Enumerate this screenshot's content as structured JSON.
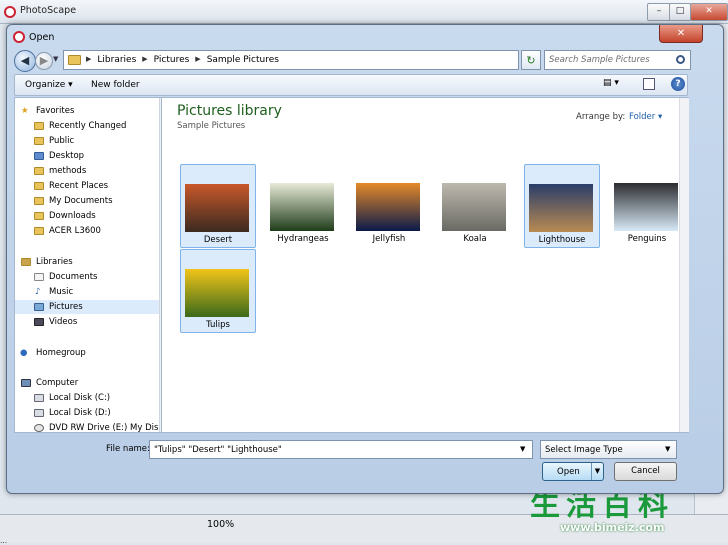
{
  "background_app": {
    "title": "PhotoScape",
    "window_buttons": [
      "–",
      "□",
      "✕"
    ],
    "zoom": "100%",
    "status_text": "...",
    "watermark": "生活百科",
    "watermark_url": "www.bimeiz.com"
  },
  "dialog": {
    "title": "Open",
    "close_label": "✕",
    "breadcrumb": [
      "Libraries",
      "Pictures",
      "Sample Pictures"
    ],
    "search_placeholder": "Search Sample Pictures",
    "toolbar": {
      "organize": "Organize ▾",
      "new_folder": "New folder",
      "help": "?"
    },
    "nav_pane": {
      "favorites_header": "Favorites",
      "favorites": [
        "Recently Changed",
        "Public",
        "Desktop",
        "methods",
        "Recent Places",
        "My Documents",
        "Downloads",
        "ACER L3600"
      ],
      "libraries_header": "Libraries",
      "libraries": [
        "Documents",
        "Music",
        "Pictures",
        "Videos"
      ],
      "homegroup": "Homegroup",
      "computer_header": "Computer",
      "computer": [
        "Local Disk (C:)",
        "Local Disk (D:)",
        "DVD RW Drive (E:) My Disc"
      ]
    },
    "library_title": "Pictures library",
    "library_subtitle": "Sample Pictures",
    "arrange_label": "Arrange by:",
    "arrange_value": "Folder ▾",
    "files": [
      {
        "name": "Desert",
        "selected": true,
        "colors": [
          "#3b2a20",
          "#c8582a"
        ]
      },
      {
        "name": "Hydrangeas",
        "selected": false,
        "colors": [
          "#1f3c1a",
          "#e8ead8"
        ]
      },
      {
        "name": "Jellyfish",
        "selected": false,
        "colors": [
          "#0a1a4a",
          "#e58a2a"
        ]
      },
      {
        "name": "Koala",
        "selected": false,
        "colors": [
          "#6a6a64",
          "#bdb8ae"
        ]
      },
      {
        "name": "Lighthouse",
        "selected": true,
        "colors": [
          "#b98a52",
          "#2a3e6a"
        ]
      },
      {
        "name": "Penguins",
        "selected": false,
        "colors": [
          "#d8eaf7",
          "#2c2c30"
        ]
      },
      {
        "name": "Tulips",
        "selected": true,
        "colors": [
          "#3a6a1a",
          "#f2c41a"
        ]
      }
    ],
    "file_name_label": "File name:",
    "file_name_value": "\"Tulips\" \"Desert\" \"Lighthouse\"",
    "file_type": "Select Image Type",
    "open_label": "Open",
    "cancel_label": "Cancel"
  }
}
